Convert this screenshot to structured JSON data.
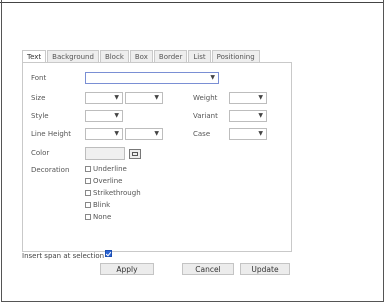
{
  "tabs": [
    "Text",
    "Background",
    "Block",
    "Box",
    "Border",
    "List",
    "Positioning"
  ],
  "active_tab": "Text",
  "fields": {
    "font": {
      "label": "Font",
      "value": ""
    },
    "size": {
      "label": "Size"
    },
    "weight": {
      "label": "Weight"
    },
    "style": {
      "label": "Style"
    },
    "variant": {
      "label": "Variant"
    },
    "line_height": {
      "label": "Line Height"
    },
    "case": {
      "label": "Case"
    },
    "color": {
      "label": "Color",
      "value": ""
    },
    "decoration": {
      "label": "Decoration"
    }
  },
  "decorations": [
    "Underline",
    "Overline",
    "Strikethrough",
    "Blink",
    "None"
  ],
  "insert_span": {
    "label": "Insert span at selection",
    "checked": true
  },
  "buttons": {
    "apply": "Apply",
    "cancel": "Cancel",
    "update": "Update"
  },
  "icons": {
    "dropdown": "chevron-down-icon",
    "color_picker": "color-picker-icon",
    "checkbox_checked": "checkmark-icon"
  },
  "colors": {
    "checkbox_checked": "#2a64d6",
    "focus_border": "#7a8fd4"
  }
}
